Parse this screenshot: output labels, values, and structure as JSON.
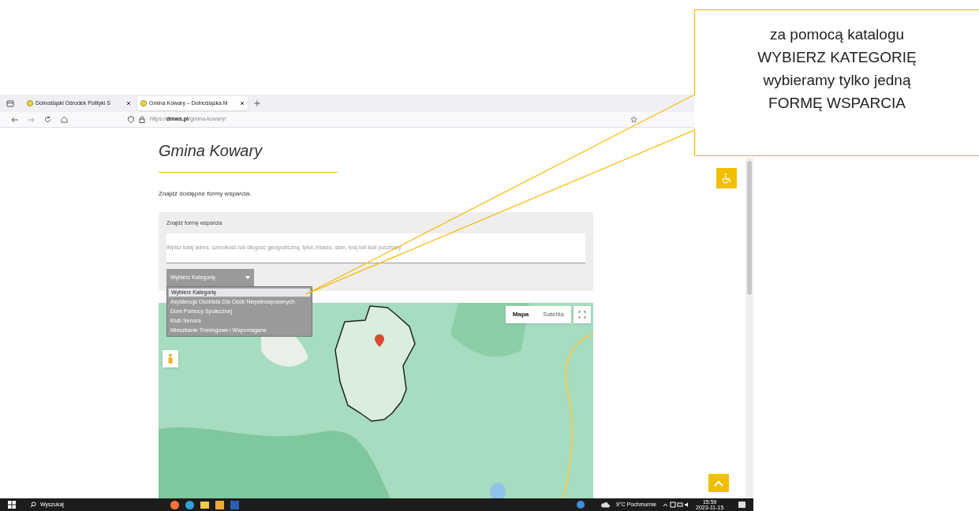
{
  "browser": {
    "tabs": [
      {
        "label": "Dolnośląski Ośrodek Polityki S",
        "selected": false
      },
      {
        "label": "Gmina Kowary – Dolnośląska M",
        "selected": true
      }
    ],
    "url_prefix": "https://",
    "url_domain": "dmws.pl",
    "url_path": "/gmina-kowary/"
  },
  "page": {
    "title": "Gmina Kowary",
    "intro": "Znajdź dostępne formy wsparcia.",
    "search_label": "Znajdź formę wsparcia",
    "search_placeholder": "Wpisz tutaj adres, szerokość lub długość geograficzną, tytuł, miasto, stan, kraj lub kod pocztowy",
    "category_select": "Wybierz Kategorię",
    "category_options": [
      {
        "label": "Wybierz Kategorię",
        "selected": true
      },
      {
        "label": "Asystencja Osobista Dla Osób Niepełnosprawnych",
        "selected": false
      },
      {
        "label": "Dom Pomocy Społecznej",
        "selected": false
      },
      {
        "label": "Klub Senora",
        "selected": false
      },
      {
        "label": "Mieszkanie Treningowe i Wspomagane",
        "selected": false
      }
    ],
    "map_types": [
      {
        "label": "Mapa",
        "selected": true
      },
      {
        "label": "Satelita",
        "selected": false
      }
    ]
  },
  "callout": {
    "lines": [
      "za pomocą katalogu",
      "WYBIERZ KATEGORIĘ",
      "wybieramy tylko jedną",
      "FORMĘ WSPARCIA"
    ]
  },
  "taskbar": {
    "search": "Wyszukaj",
    "weather": "9°C Pochmurnie",
    "time": "15:59",
    "date": "2023-11-15"
  }
}
